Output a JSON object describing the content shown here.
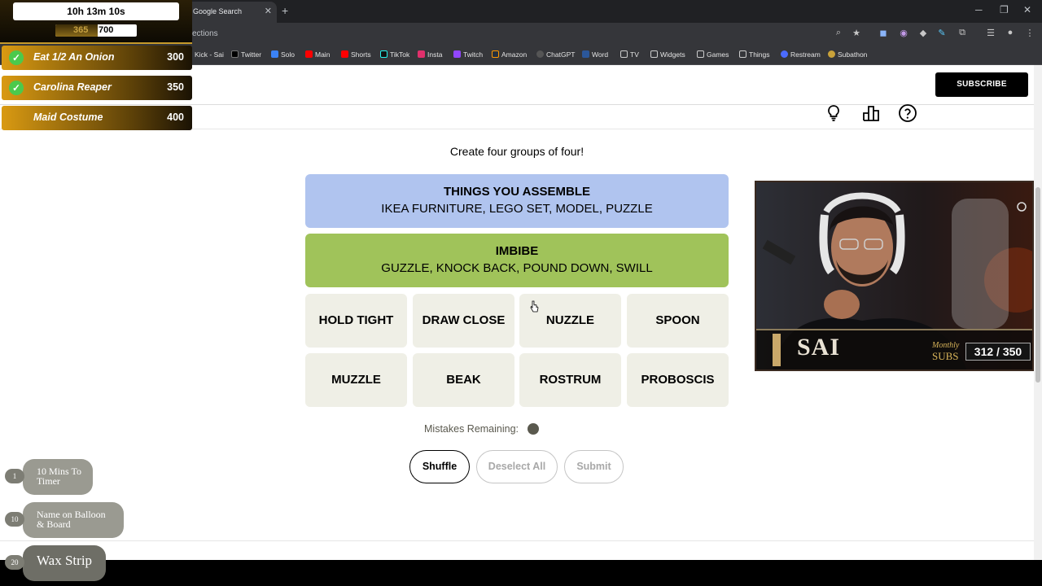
{
  "browser": {
    "tab_title": "Google Search",
    "url_fragment": "ections",
    "bookmarks": [
      "Kick - Sai",
      "Twitter",
      "Solo",
      "Main",
      "Shorts",
      "TikTok",
      "Insta",
      "Twitch",
      "Amazon",
      "ChatGPT",
      "Word",
      "TV",
      "Widgets",
      "Games",
      "Things",
      "Restream",
      "Subathon"
    ]
  },
  "site": {
    "subscribe_label": "SUBSCRIBE",
    "icons": [
      "lightbulb-icon",
      "leaderboard-icon",
      "help-icon"
    ]
  },
  "game": {
    "instructions": "Create four groups of four!",
    "solved": [
      {
        "category": "THINGS YOU ASSEMBLE",
        "words": "IKEA FURNITURE, LEGO SET, MODEL, PUZZLE",
        "color": "#b0c4ef"
      },
      {
        "category": "IMBIBE",
        "words": "GUZZLE, KNOCK BACK, POUND DOWN, SWILL",
        "color": "#a0c35a"
      }
    ],
    "cards": [
      "HOLD TIGHT",
      "DRAW CLOSE",
      "NUZZLE",
      "SPOON",
      "MUZZLE",
      "BEAK",
      "ROSTRUM",
      "PROBOSCIS"
    ],
    "mistakes_label": "Mistakes Remaining:",
    "mistakes_remaining": 1,
    "buttons": {
      "shuffle": "Shuffle",
      "deselect": "Deselect All",
      "submit": "Submit"
    }
  },
  "overlay": {
    "timer": "10h 13m 10s",
    "progress_current": "365",
    "progress_goal": "700",
    "progress_fraction": 0.52,
    "goals": [
      {
        "label": "Eat 1/2 An Onion",
        "value": "300",
        "done": true
      },
      {
        "label": "Carolina Reaper",
        "value": "350",
        "done": true
      },
      {
        "label": "Maid Costume",
        "value": "400",
        "done": false
      }
    ],
    "redeems": [
      {
        "cost": "1",
        "label_line1": "10 Mins To",
        "label_line2": "Timer"
      },
      {
        "cost": "10",
        "label_line1": "Name on Balloon",
        "label_line2": "& Board"
      },
      {
        "cost": "20",
        "label_line1": "Wax Strip",
        "label_line2": ""
      }
    ]
  },
  "webcam": {
    "name": "SAI",
    "subs_label_top": "Monthly",
    "subs_label_bottom": "SUBS",
    "subs_count": "312 / 350"
  }
}
